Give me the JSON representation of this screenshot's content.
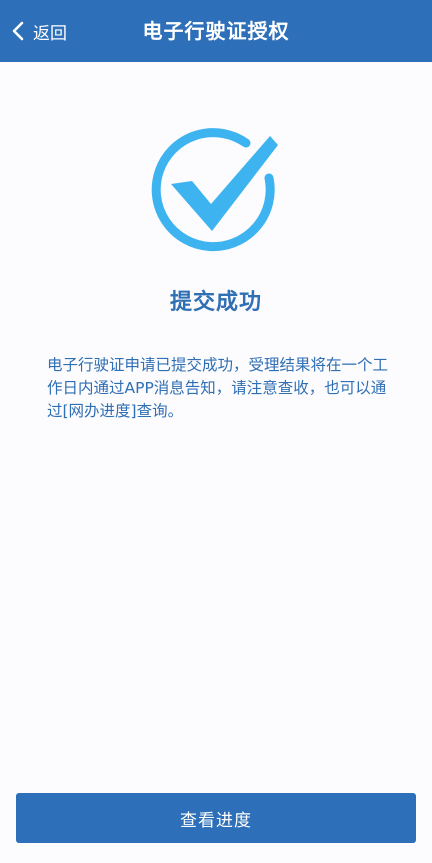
{
  "header": {
    "back_label": "返回",
    "title": "电子行驶证授权"
  },
  "result": {
    "icon": "check-circle-icon",
    "title": "提交成功",
    "message": "电子行驶证申请已提交成功，受理结果将在一个工作日内通过APP消息告知，请注意查收，也可以通过[网办进度]查询。"
  },
  "actions": {
    "view_progress_label": "查看进度"
  },
  "colors": {
    "header_bg": "#2e6fb9",
    "accent_text": "#2f6fb4",
    "icon": "#3db3f0",
    "page_bg": "#fcfbfe"
  }
}
